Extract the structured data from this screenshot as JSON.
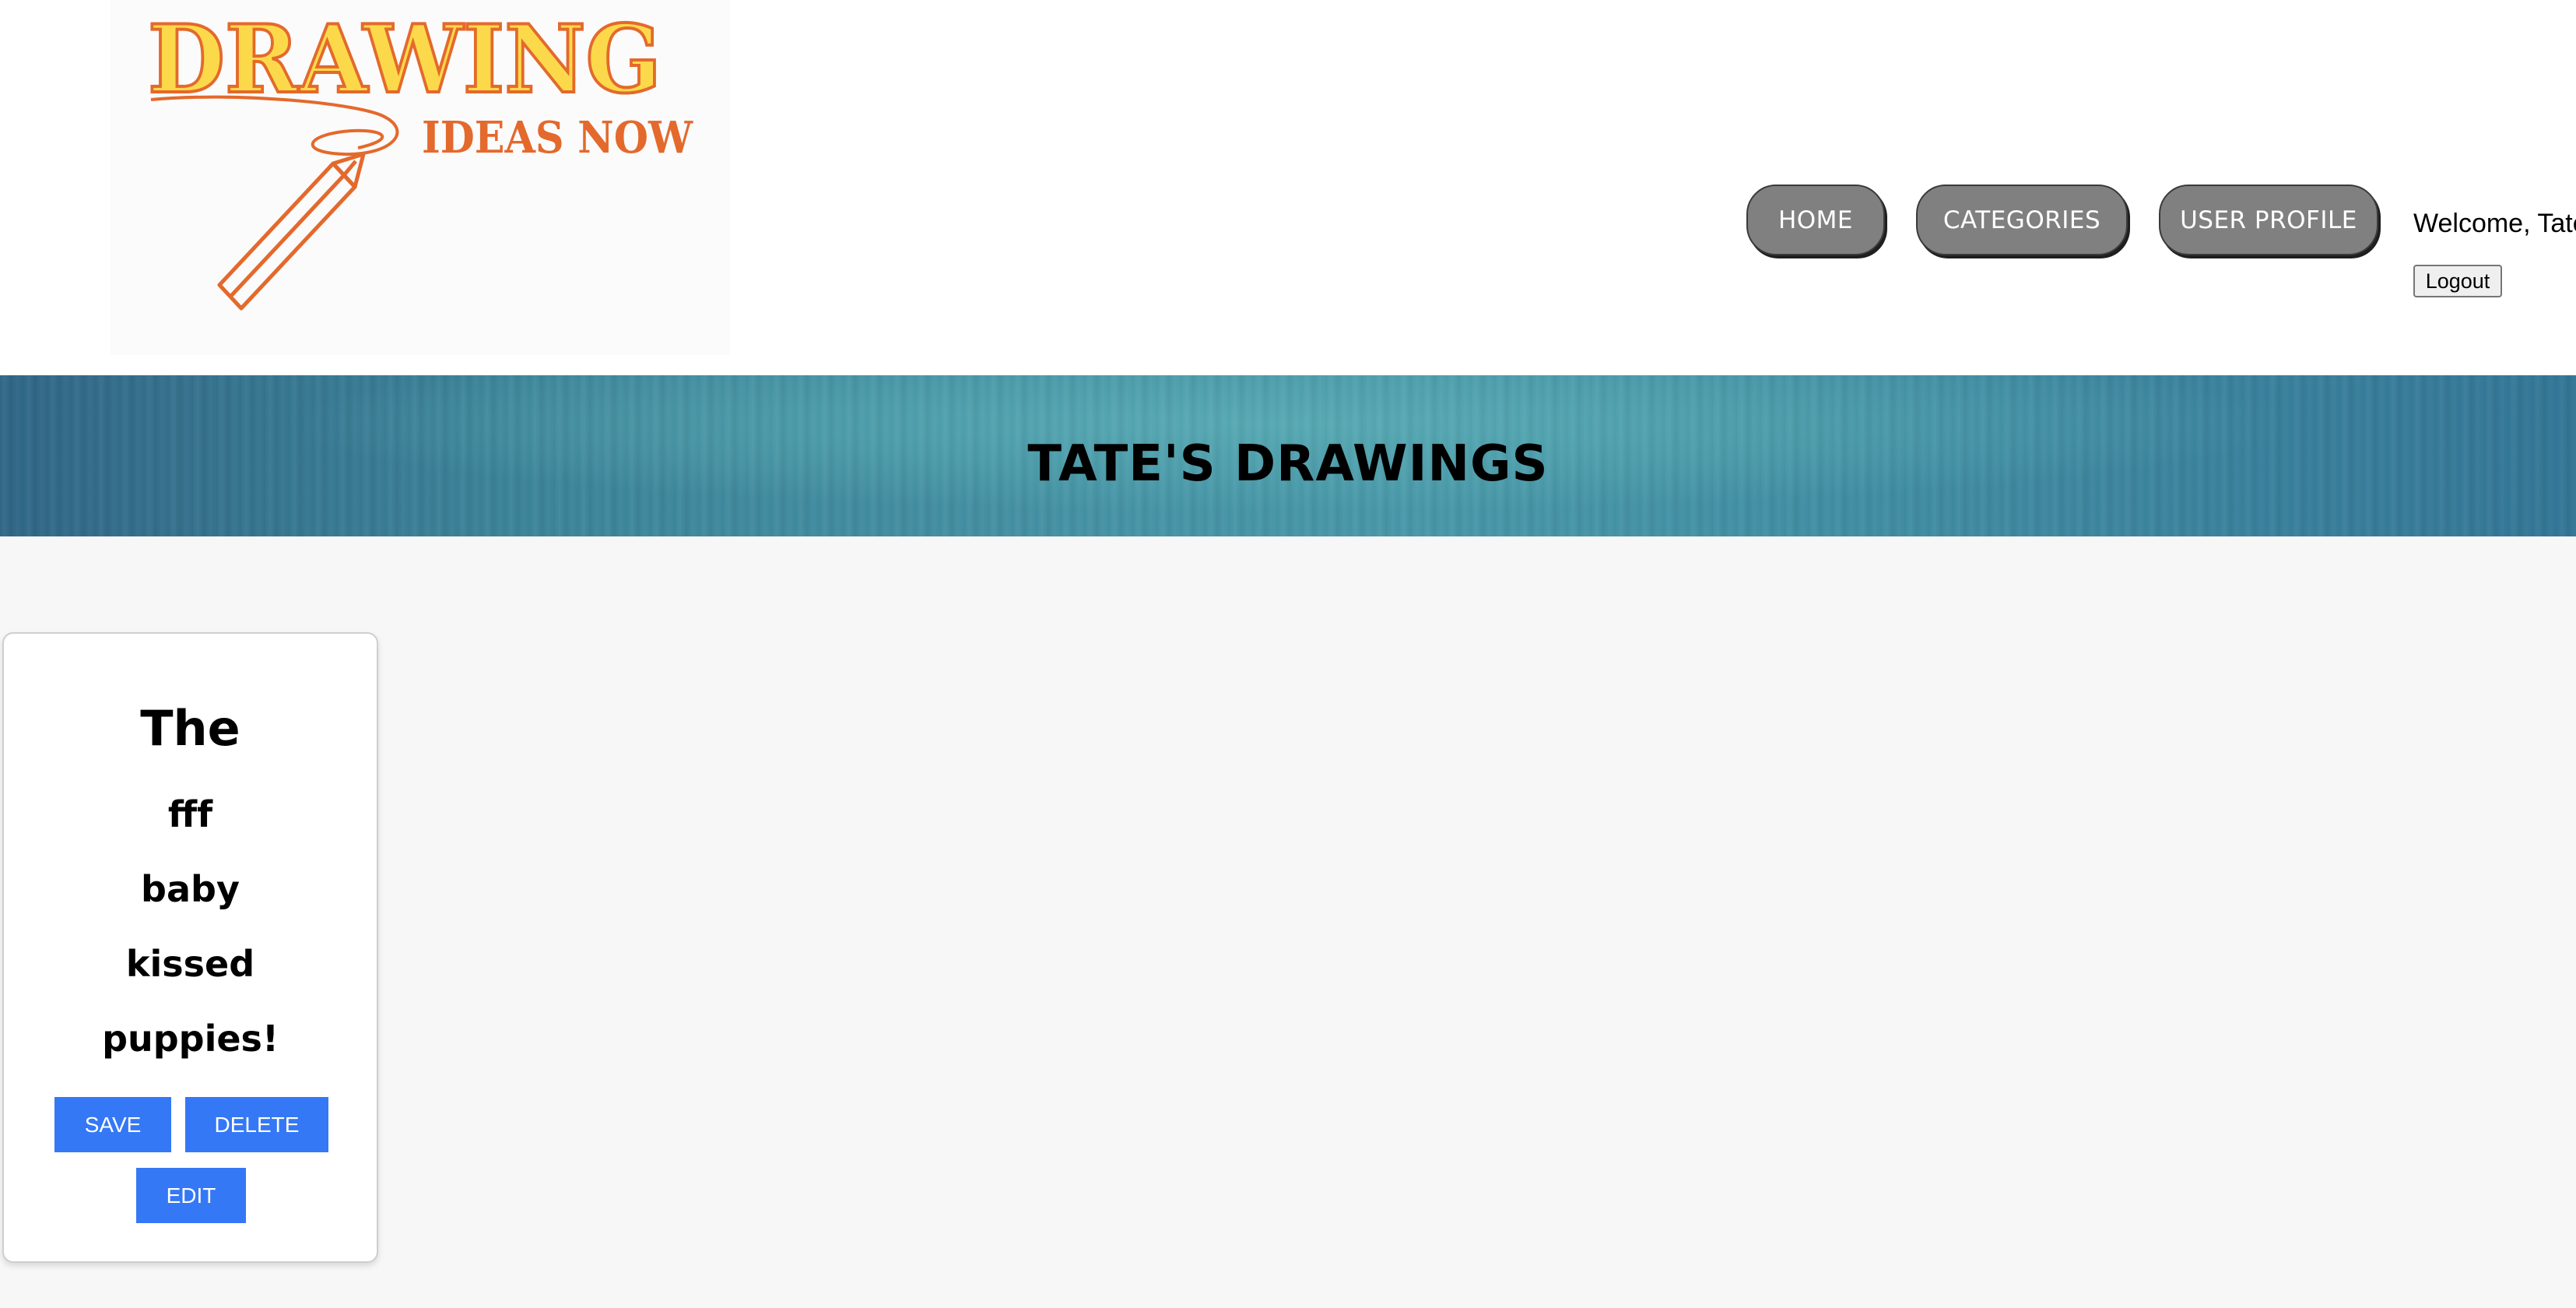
{
  "header": {
    "logo": {
      "line1": "DRAWING",
      "line2": "IDEAS NOW",
      "colors": {
        "yellow": "#fcd94a",
        "orange": "#e4692c"
      },
      "icon": "pencil-icon"
    },
    "nav": {
      "home": "HOME",
      "categories": "CATEGORIES",
      "user_profile": "USER PROFILE"
    },
    "welcome_text": "Welcome, Tate",
    "logout_label": "Logout"
  },
  "banner": {
    "title": "TATE'S DRAWINGS"
  },
  "drawings": [
    {
      "lines": [
        "The",
        "fff",
        "baby",
        "kissed",
        "puppies!"
      ],
      "save_label": "SAVE",
      "delete_label": "DELETE",
      "edit_label": "EDIT"
    }
  ],
  "colors": {
    "nav_button": "#808080",
    "action_button": "#3478f6",
    "banner": "#4593a5"
  }
}
